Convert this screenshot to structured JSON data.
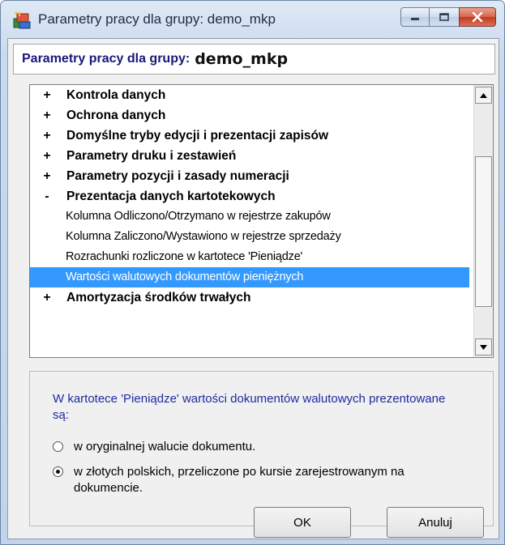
{
  "window": {
    "title": "Parametry pracy dla grupy: demo_mkp",
    "colors": {
      "selection": "#3399ff",
      "header_text": "#18187a",
      "description_text": "#1e2aa0"
    }
  },
  "header": {
    "label": "Parametry pracy dla grupy:",
    "group_name": "demo_mkp"
  },
  "tree": {
    "items": [
      {
        "expander": "+",
        "label": "Kontrola danych",
        "type": "group"
      },
      {
        "expander": "+",
        "label": "Ochrona danych",
        "type": "group"
      },
      {
        "expander": "+",
        "label": "Domyślne tryby edycji i prezentacji zapisów",
        "type": "group"
      },
      {
        "expander": "+",
        "label": "Parametry druku i zestawień",
        "type": "group"
      },
      {
        "expander": "+",
        "label": "Parametry pozycji i zasady numeracji",
        "type": "group"
      },
      {
        "expander": "-",
        "label": "Prezentacja danych kartotekowych",
        "type": "group"
      },
      {
        "expander": "",
        "label": "Kolumna Odliczono/Otrzymano w rejestrze zakupów",
        "type": "child"
      },
      {
        "expander": "",
        "label": "Kolumna Zaliczono/Wystawiono w rejestrze sprzedaży",
        "type": "child"
      },
      {
        "expander": "",
        "label": "Rozrachunki rozliczone w kartotece 'Pieniądze'",
        "type": "child"
      },
      {
        "expander": "",
        "label": "Wartości walutowych dokumentów pieniężnych",
        "type": "child",
        "selected": true
      },
      {
        "expander": "+",
        "label": "Amortyzacja środków trwałych",
        "type": "group"
      }
    ]
  },
  "description": {
    "text": "W kartotece 'Pieniądze' wartości dokumentów walutowych prezentowane są:",
    "options": [
      {
        "label": "w oryginalnej walucie dokumentu.",
        "checked": false
      },
      {
        "label": "w złotych polskich, przeliczone po kursie zarejestrowanym na dokumencie.",
        "checked": true
      }
    ]
  },
  "buttons": {
    "ok": "OK",
    "cancel": "Anuluj"
  }
}
